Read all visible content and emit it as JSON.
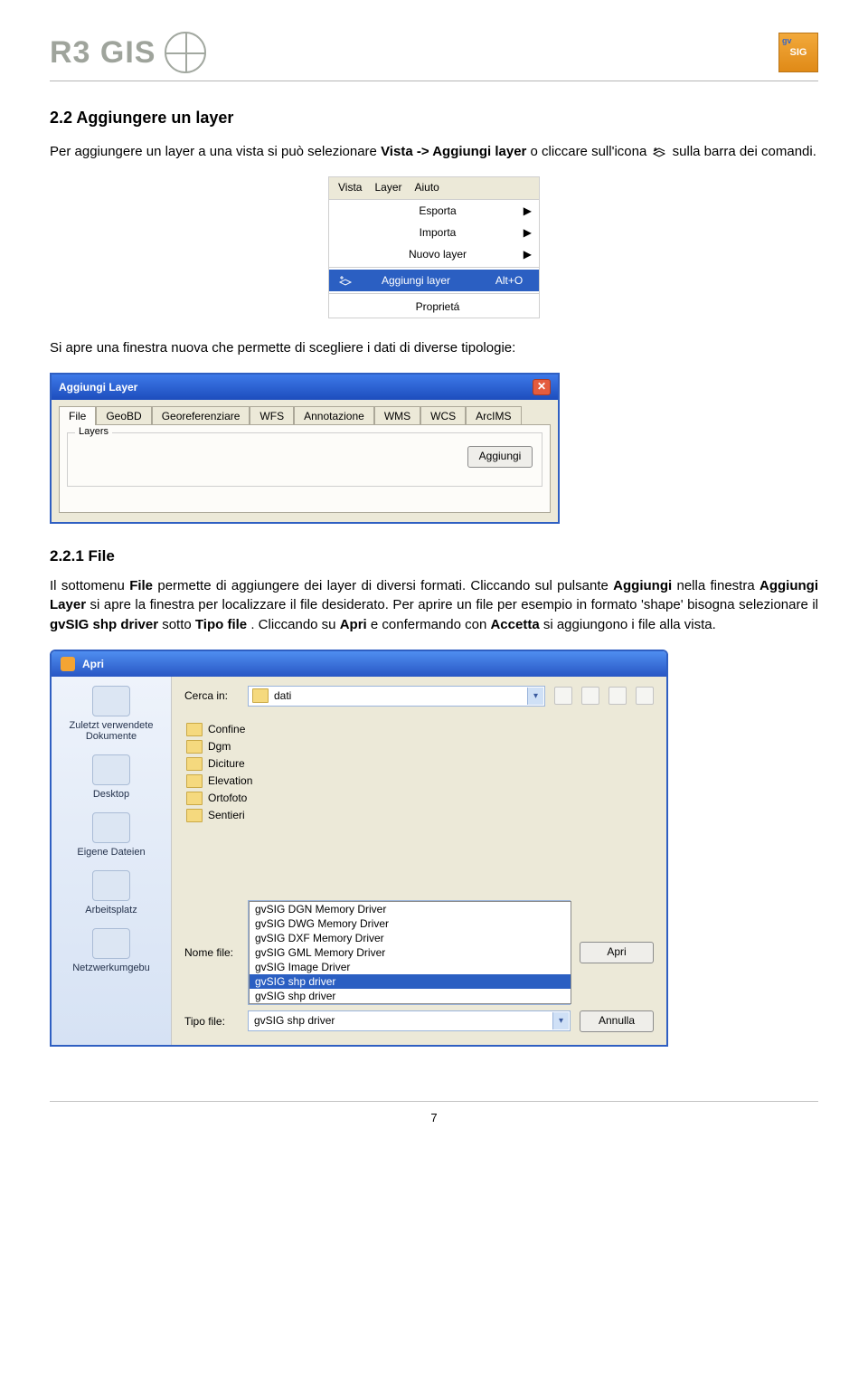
{
  "header": {
    "brand": "R3 GIS",
    "gvsig_top": "gv",
    "gvsig_main": "SIG"
  },
  "section": {
    "num_title": "2.2   Aggiungere un layer",
    "p1_a": "Per aggiungere un layer a una vista si può selezionare ",
    "p1_b": "Vista -> Aggiungi layer",
    "p1_c": " o cliccare sull'icona ",
    "p1_d": " sulla barra dei comandi."
  },
  "menu": {
    "bar": [
      "Vista",
      "Layer",
      "Aiuto"
    ],
    "items": [
      {
        "label": "Esporta",
        "arrow": true
      },
      {
        "label": "Importa",
        "arrow": true
      },
      {
        "label": "Nuovo layer",
        "arrow": true
      }
    ],
    "highlight": {
      "label": "Aggiungi layer",
      "shortcut": "Alt+O"
    },
    "last": {
      "label": "Proprietá"
    }
  },
  "after_menu": "Si apre una finestra nuova che permette di scegliere i dati di diverse tipologie:",
  "addlayer": {
    "title": "Aggiungi Layer",
    "tabs": [
      "File",
      "GeoBD",
      "Georeferenziare",
      "WFS",
      "Annotazione",
      "WMS",
      "WCS",
      "ArcIMS"
    ],
    "frame_label": "Layers",
    "button": "Aggiungi"
  },
  "subsection": {
    "num_title": "2.2.1   File",
    "para_a": "Il sottomenu ",
    "para_b": "File",
    "para_c": " permette di aggiungere dei layer di diversi formati. Cliccando sul pulsante ",
    "para_d": "Aggiungi",
    "para_e": " nella finestra ",
    "para_f": "Aggiungi Layer",
    "para_g": " si apre la finestra per localizzare il file desiderato. Per aprire un file per esempio in formato 'shape' bisogna selezionare il ",
    "para_h": "gvSIG shp driver",
    "para_i": " sotto ",
    "para_j": "Tipo file",
    "para_k": ". Cliccando su ",
    "para_l": "Apri",
    "para_m": " e confermando con ",
    "para_n": "Accetta",
    "para_o": " si aggiungono i file alla vista."
  },
  "apri": {
    "title": "Apri",
    "lookin_label": "Cerca in:",
    "lookin_value": "dati",
    "places": [
      "Zuletzt verwendete Dokumente",
      "Desktop",
      "Eigene Dateien",
      "Arbeitsplatz",
      "Netzwerkumgebu"
    ],
    "folders": [
      "Confine",
      "Dgm",
      "Diciture",
      "Elevation",
      "Ortofoto",
      "Sentieri"
    ],
    "name_label": "Nome file:",
    "type_label": "Tipo file:",
    "drivers": [
      "gvSIG DGN Memory Driver",
      "gvSIG DWG Memory Driver",
      "gvSIG DXF Memory Driver",
      "gvSIG GML Memory Driver",
      "gvSIG Image Driver",
      "gvSIG shp driver",
      "gvSIG shp driver"
    ],
    "selected_driver_index": 5,
    "tipo_value": "gvSIG shp driver",
    "btn_open": "Apri",
    "btn_cancel": "Annulla"
  },
  "page_number": "7"
}
